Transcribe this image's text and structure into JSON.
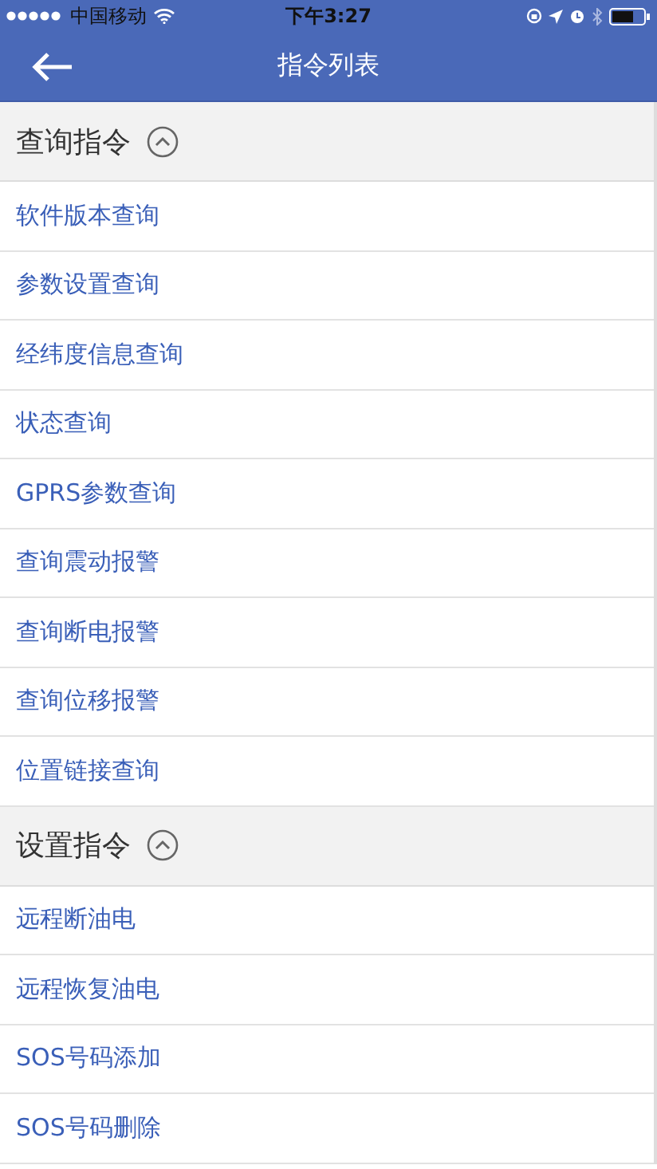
{
  "status_bar": {
    "carrier": "中国移动",
    "time": "下午3:27"
  },
  "header": {
    "title": "指令列表"
  },
  "sections": [
    {
      "title": "查询指令",
      "expanded": true,
      "items": [
        "软件版本查询",
        "参数设置查询",
        "经纬度信息查询",
        "状态查询",
        "GPRS参数查询",
        "查询震动报警",
        "查询断电报警",
        "查询位移报警",
        "位置链接查询"
      ]
    },
    {
      "title": "设置指令",
      "expanded": true,
      "items": [
        "远程断油电",
        "远程恢复油电",
        "SOS号码添加",
        "SOS号码删除"
      ]
    }
  ]
}
